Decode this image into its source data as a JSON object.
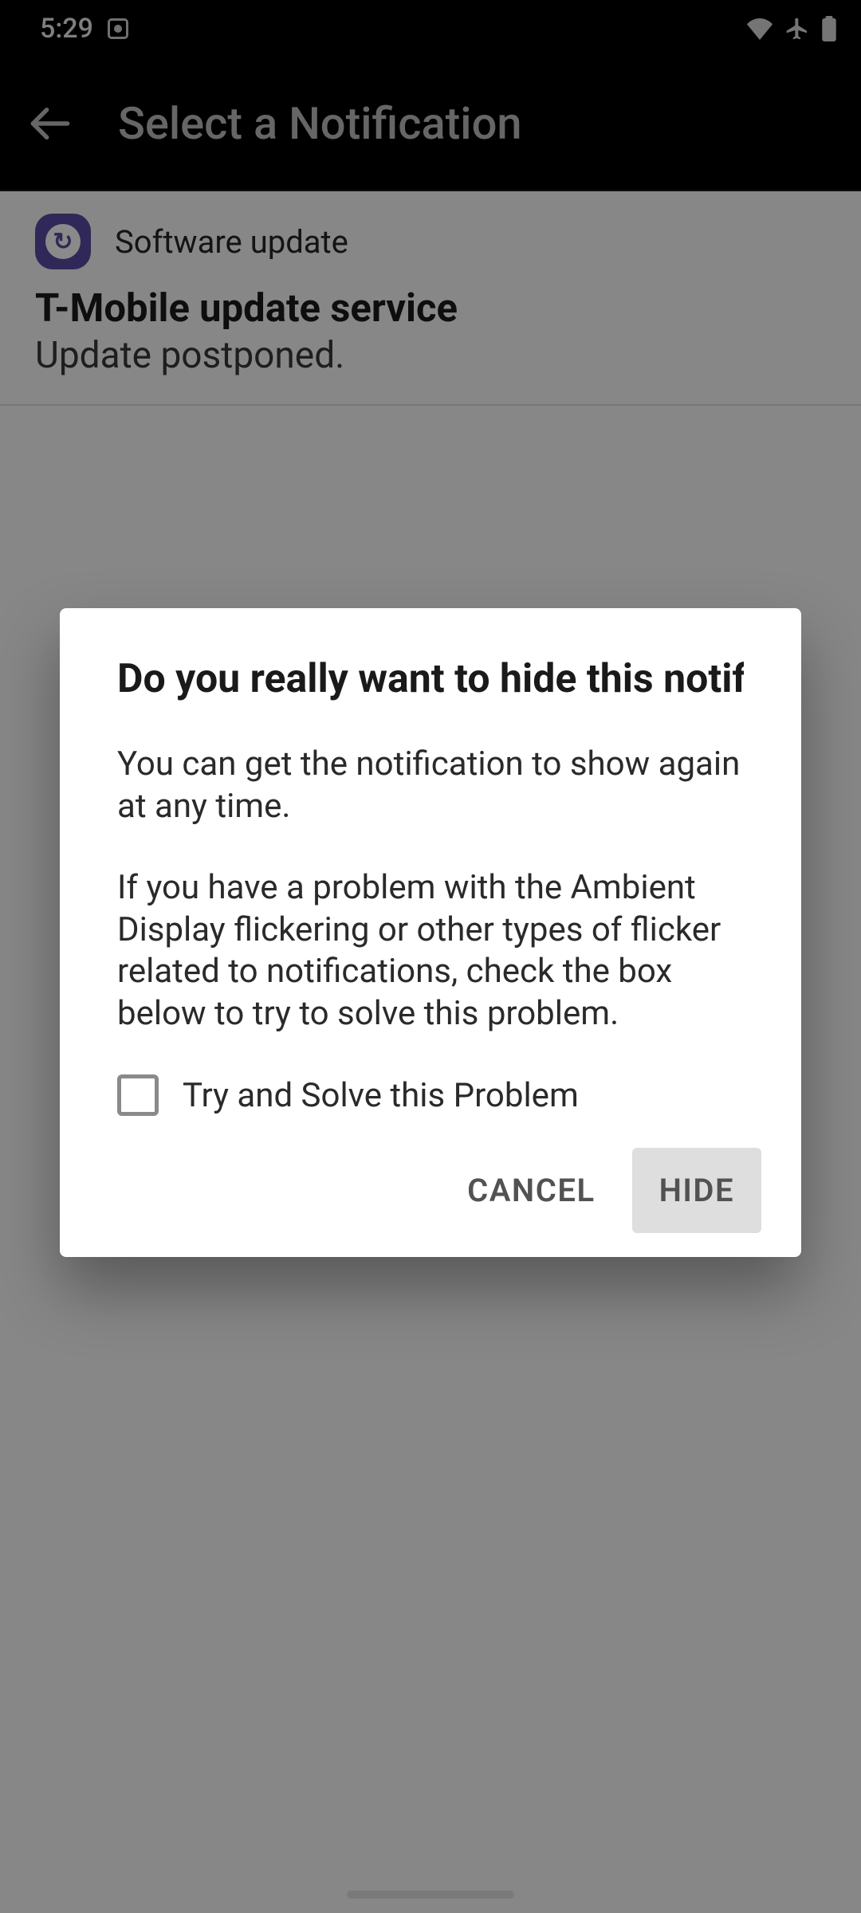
{
  "status_bar": {
    "time": "5:29"
  },
  "app_bar": {
    "title": "Select a Notification"
  },
  "notification": {
    "app_name": "Software update",
    "title": "T-Mobile update service",
    "subtitle": "Update postponed."
  },
  "dialog": {
    "title": "Do you really want to hide this notification?",
    "message_line1": "You can get the notification to show again at any time.",
    "message_line2": "If you have a problem with the Ambient Display flickering or other types of flicker related to notifications, check the box below to try to solve this problem.",
    "checkbox_label": "Try and Solve this Problem",
    "checkbox_checked": false,
    "cancel_label": "CANCEL",
    "confirm_label": "HIDE"
  }
}
